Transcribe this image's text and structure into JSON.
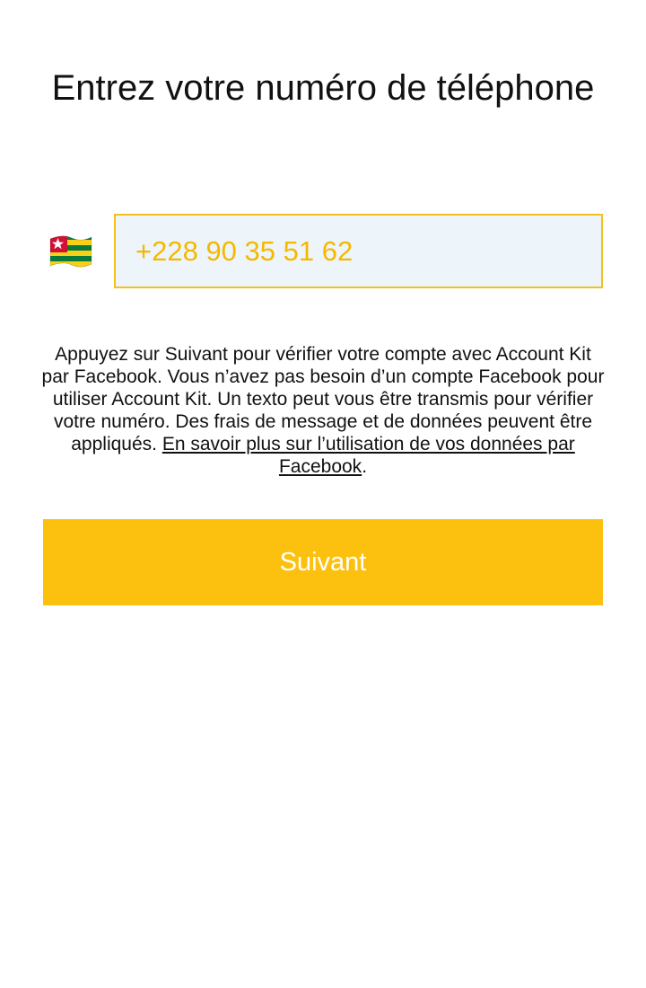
{
  "header": {
    "title": "Entrez votre numéro de téléphone"
  },
  "phone": {
    "country_flag": "togo-flag-icon",
    "value": "+228 90 35 51 62"
  },
  "disclaimer": {
    "text": "Appuyez sur Suivant pour vérifier votre compte avec Account Kit par Facebook. Vous n’avez pas besoin d’un compte Facebook pour utiliser Account Kit. Un texto peut vous être transmis pour vérifier votre numéro. Des frais de message et de données peuvent être appliqués. ",
    "link_text": "En savoir plus sur l’utilisation de vos données par Facebook",
    "suffix": "."
  },
  "actions": {
    "next_label": "Suivant"
  },
  "colors": {
    "accent": "#fcc10f",
    "input_border": "#f3c01f",
    "input_background": "#edf5fa",
    "input_text": "#f5b800"
  }
}
